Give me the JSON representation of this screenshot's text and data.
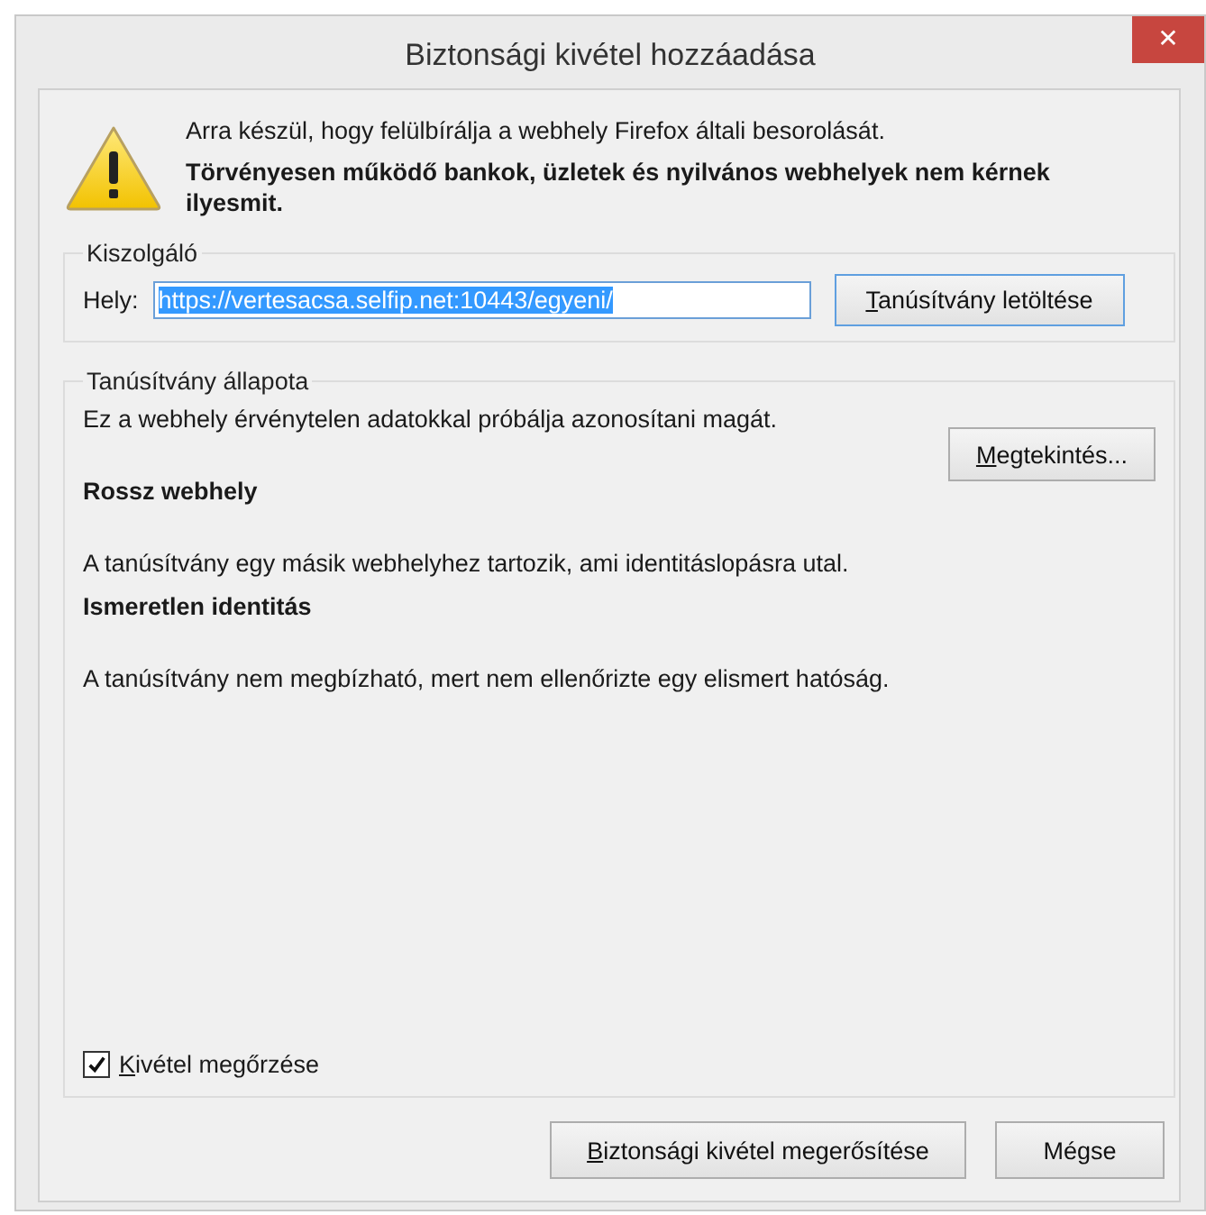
{
  "window": {
    "title": "Biztonsági kivétel hozzáadása",
    "close": "✕"
  },
  "warning": {
    "message": "Arra készül, hogy felülbírálja a webhely Firefox általi besorolását.",
    "emphasis": "Törvényesen működő bankok, üzletek és nyilvános webhelyek nem kérnek ilyesmit."
  },
  "server": {
    "legend": "Kiszolgáló",
    "label": "Hely:",
    "value": "https://vertesacsa.selfip.net:10443/egyeni/",
    "value_selected": true,
    "button": "Tanúsítvány letöltése"
  },
  "status": {
    "legend": "Tanúsítvány állapota",
    "summary": "Ez a webhely érvénytelen adatokkal próbálja azonosítani magát.",
    "button": "Megtekintés...",
    "problems": [
      {
        "heading": "Rossz webhely",
        "text": "A tanúsítvány egy másik webhelyhez tartozik, ami identitáslopásra utal."
      },
      {
        "heading": "Ismeretlen identitás",
        "text": "A tanúsítvány nem megbízható, mert nem ellenőrizte egy elismert hatóság."
      }
    ],
    "checkbox": {
      "label": "Kivétel megőrzése",
      "checked": true
    }
  },
  "buttons": [
    {
      "label": "Biztonsági kivétel megerősítése"
    },
    {
      "label": "Mégse"
    }
  ]
}
